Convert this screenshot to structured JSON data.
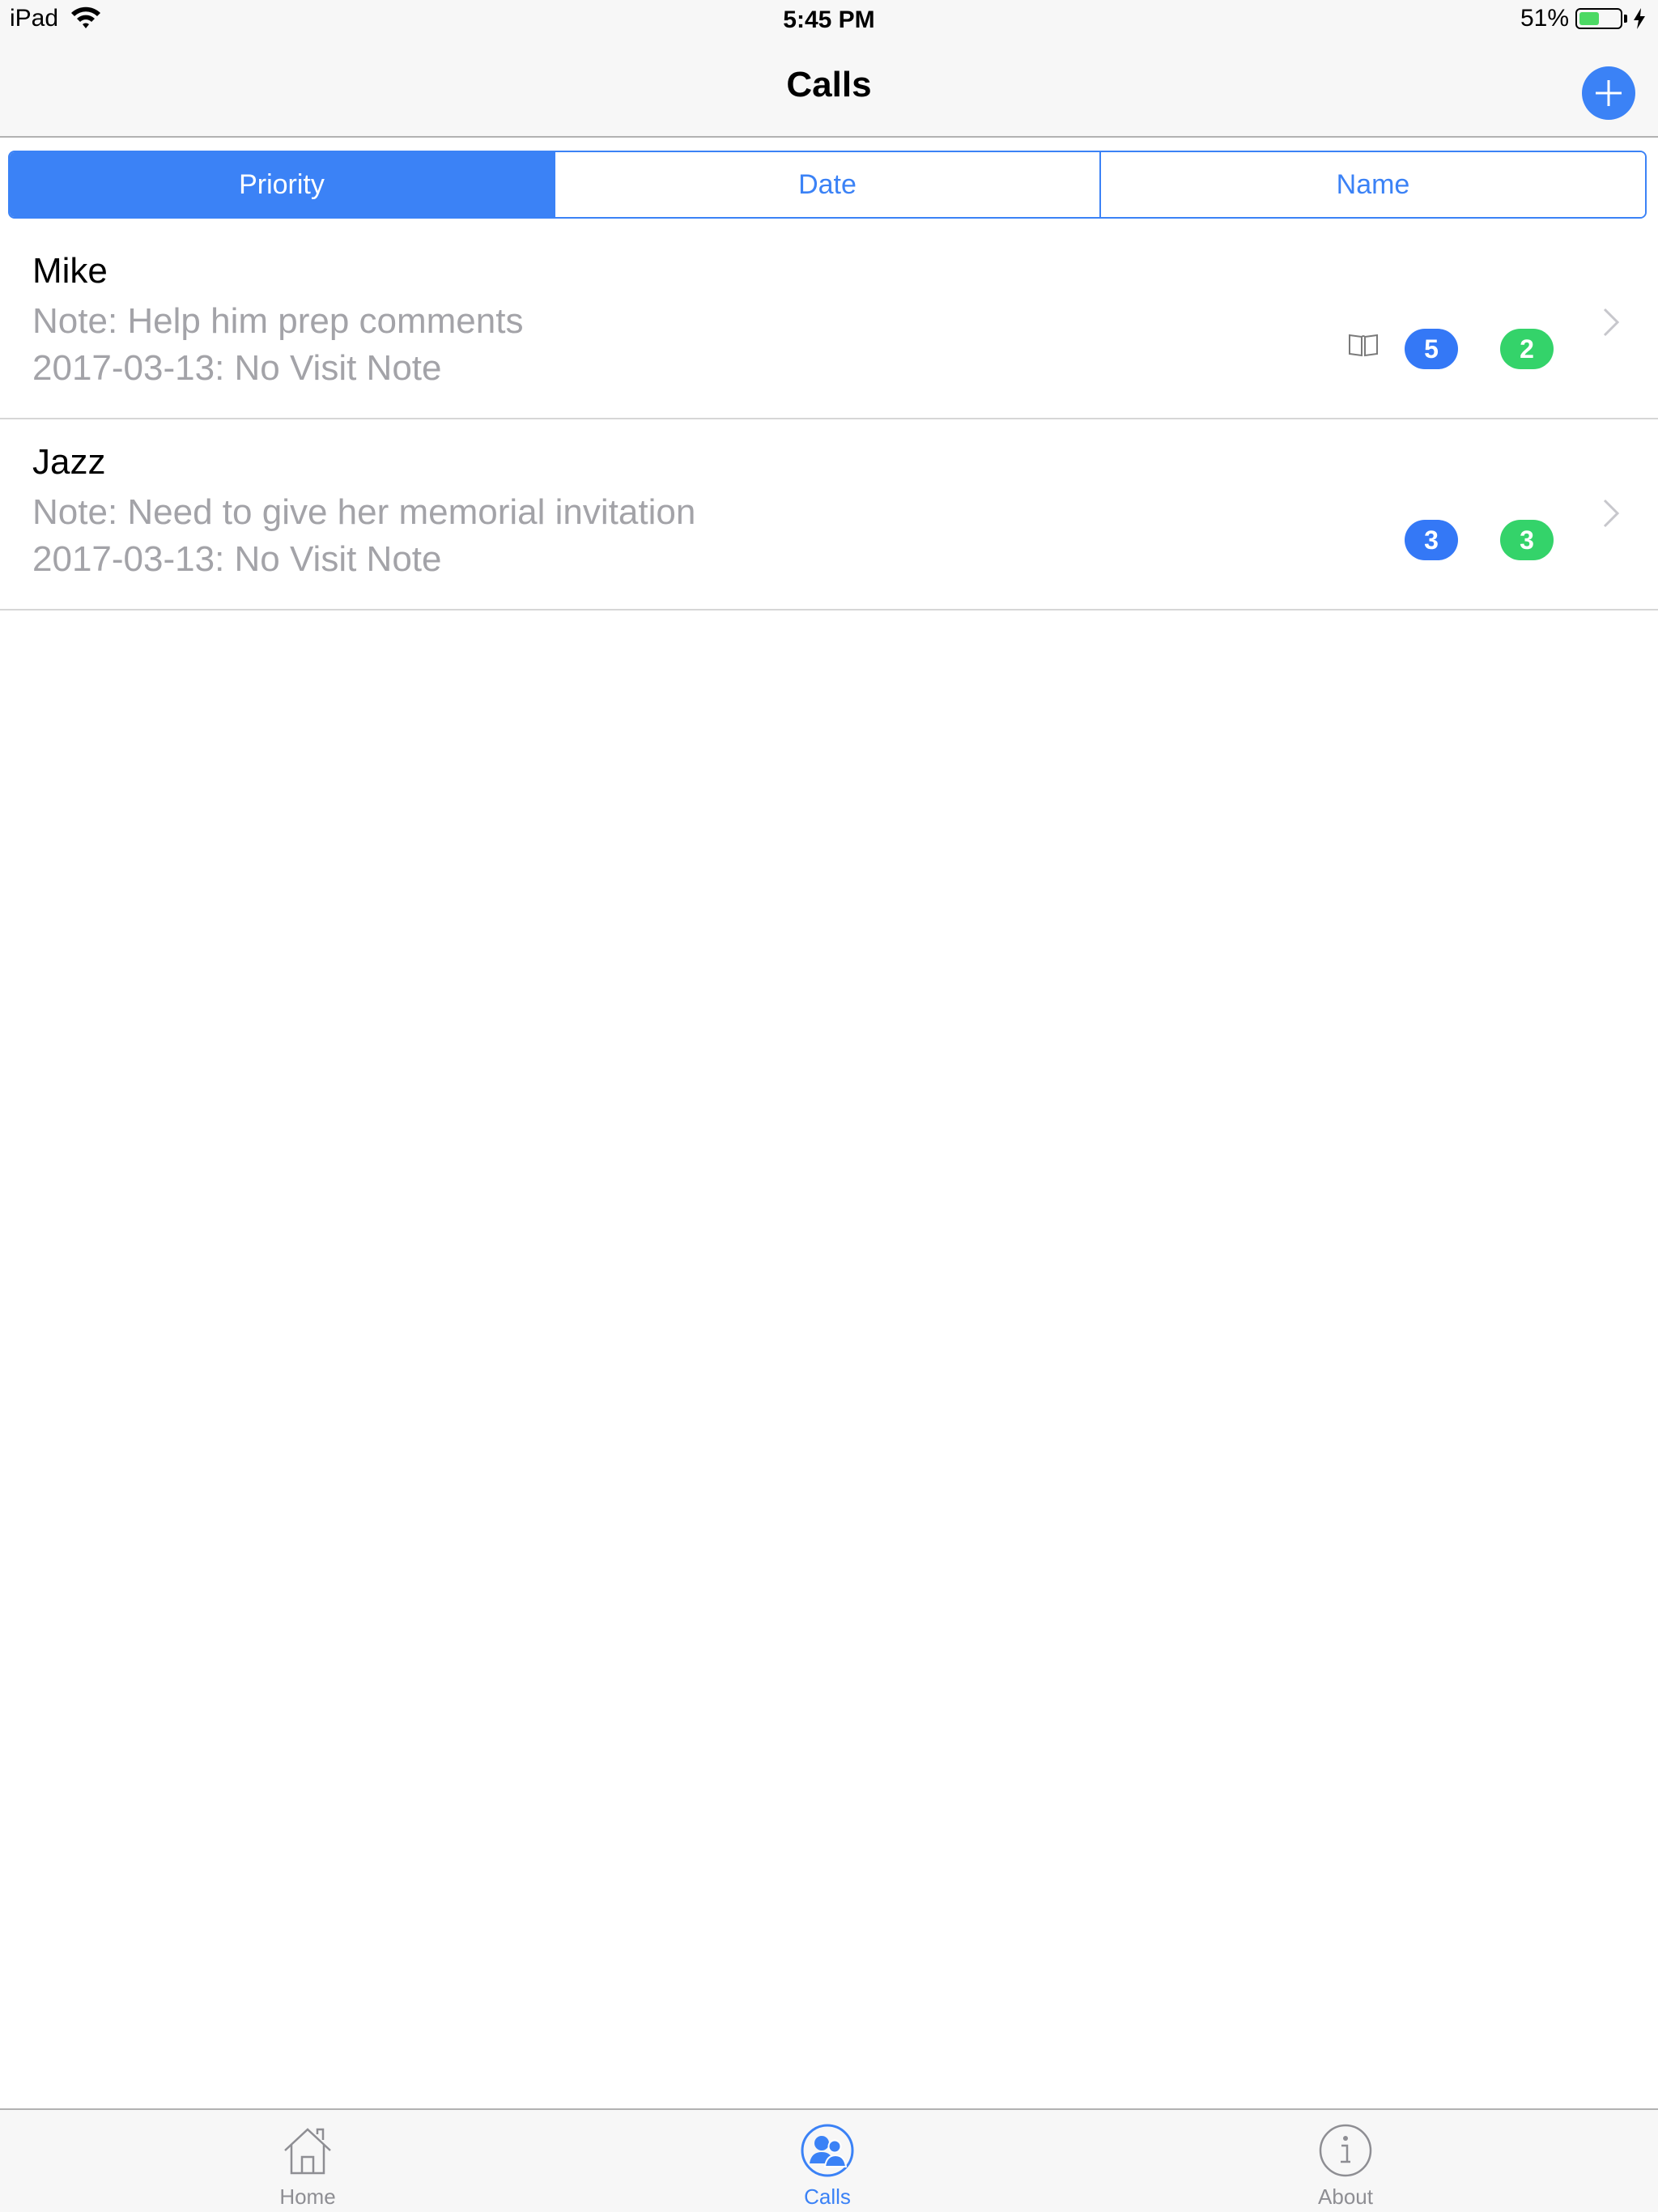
{
  "status_bar": {
    "device": "iPad",
    "time": "5:45 PM",
    "battery_percent": "51%",
    "battery_level": 0.51,
    "wifi_icon": "wifi-icon",
    "charging_icon": "bolt-icon"
  },
  "nav": {
    "title": "Calls",
    "add_icon": "plus-icon"
  },
  "segments": [
    {
      "label": "Priority",
      "selected": true
    },
    {
      "label": "Date",
      "selected": false
    },
    {
      "label": "Name",
      "selected": false
    }
  ],
  "calls": [
    {
      "name": "Mike",
      "note": "Note: Help him prep comments",
      "last_visit": "2017-03-13: No Visit Note",
      "has_book_icon": true,
      "blue_count": "5",
      "green_count": "2"
    },
    {
      "name": "Jazz",
      "note": "Note: Need to give her memorial invitation",
      "last_visit": "2017-03-13: No Visit Note",
      "has_book_icon": false,
      "blue_count": "3",
      "green_count": "3"
    }
  ],
  "tabs": [
    {
      "label": "Home",
      "icon": "home-icon",
      "active": false
    },
    {
      "label": "Calls",
      "icon": "people-icon",
      "active": true
    },
    {
      "label": "About",
      "icon": "info-icon",
      "active": false
    }
  ],
  "colors": {
    "accent": "#3b82f6",
    "badge_blue": "#3478f6",
    "badge_green": "#34d36a",
    "secondary_text": "#a3a3a8",
    "battery_fill": "#4cd964"
  }
}
